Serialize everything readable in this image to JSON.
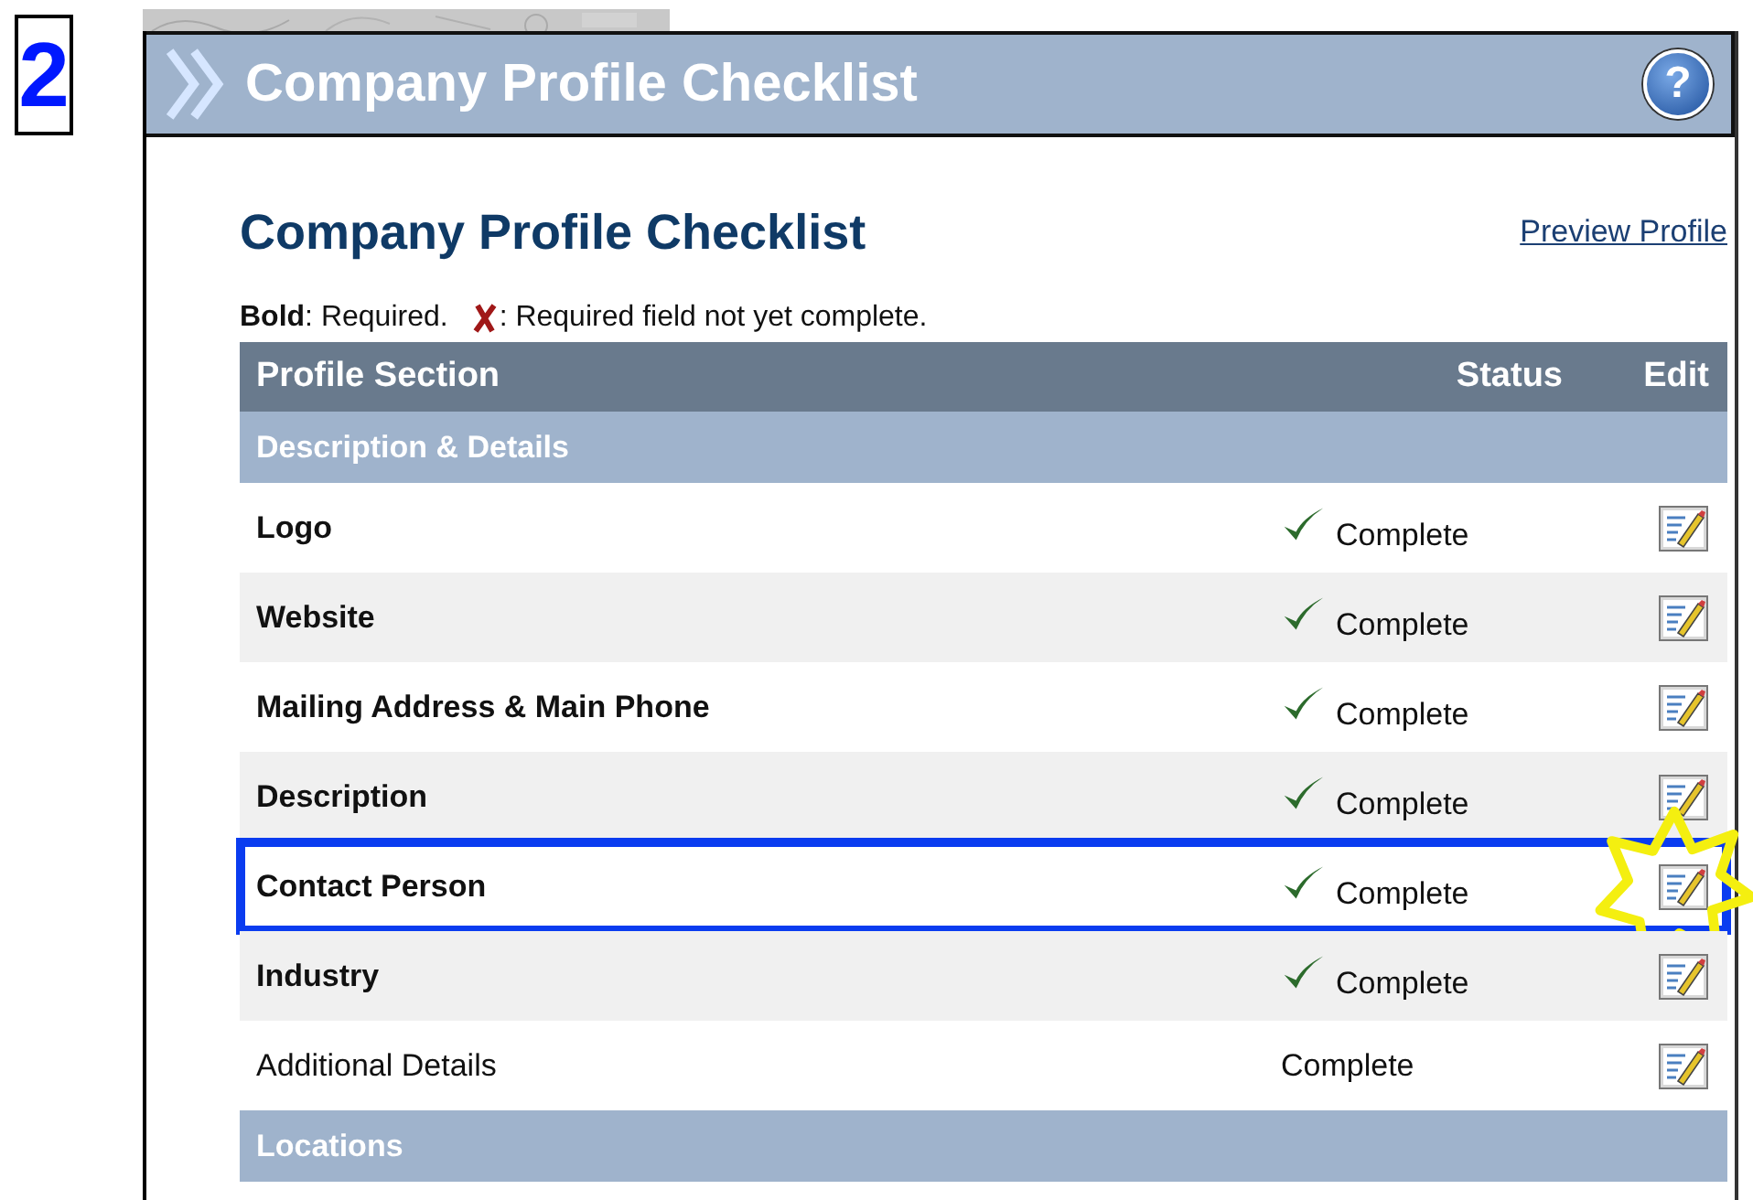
{
  "step_badge": "2",
  "panel": {
    "title": "Company Profile Checklist",
    "help": "?"
  },
  "heading": "Company Profile Checklist",
  "preview_link": "Preview Profile",
  "legend": {
    "bold_text": "**Bold**: Required.",
    "missing_text": ": Required field not yet complete."
  },
  "table": {
    "columns": [
      "Profile Section",
      "Status",
      "Edit"
    ],
    "rows": [
      {
        "kind": "group",
        "name": "Description & Details"
      },
      {
        "kind": "item",
        "name": "Logo",
        "required": true,
        "checked": true,
        "status": "Complete",
        "highlighted": false
      },
      {
        "kind": "item",
        "name": "Website",
        "required": true,
        "checked": true,
        "status": "Complete",
        "highlighted": false
      },
      {
        "kind": "item",
        "name": "Mailing Address & Main Phone",
        "required": true,
        "checked": true,
        "status": "Complete",
        "highlighted": false
      },
      {
        "kind": "item",
        "name": "Description",
        "required": true,
        "checked": true,
        "status": "Complete",
        "highlighted": false
      },
      {
        "kind": "item",
        "name": "Contact Person",
        "required": true,
        "checked": true,
        "status": "Complete",
        "highlighted": true
      },
      {
        "kind": "item",
        "name": "Industry",
        "required": true,
        "checked": true,
        "status": "Complete",
        "highlighted": false
      },
      {
        "kind": "item",
        "name": "Additional Details",
        "required": false,
        "checked": false,
        "status": "Complete",
        "highlighted": false
      },
      {
        "kind": "group",
        "name": "Locations"
      }
    ]
  }
}
